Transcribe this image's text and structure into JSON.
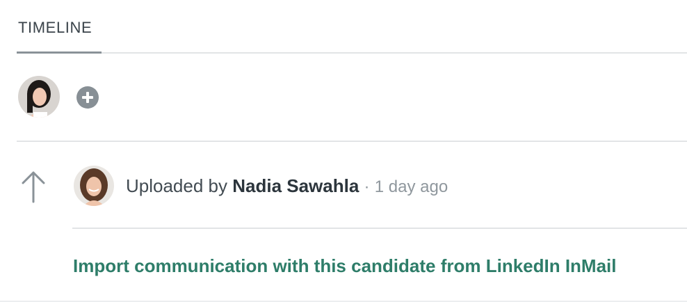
{
  "tabs": {
    "active_label": "TIMELINE"
  },
  "composer": {
    "avatar_icon": "user-avatar-photo",
    "add_icon": "plus-circle-icon"
  },
  "event": {
    "icon": "arrow-up-icon",
    "avatar_icon": "user-avatar-photo",
    "prefix": "Uploaded by",
    "user_name": "Nadia Sawahla",
    "separator": "·",
    "time": "1 day ago"
  },
  "import_link": {
    "label": "Import communication with this candidate from LinkedIn InMail"
  },
  "colors": {
    "link": "#2e7d69",
    "divider": "#e2e4e6",
    "muted": "#8f979d",
    "icon_gray": "#878f95"
  }
}
